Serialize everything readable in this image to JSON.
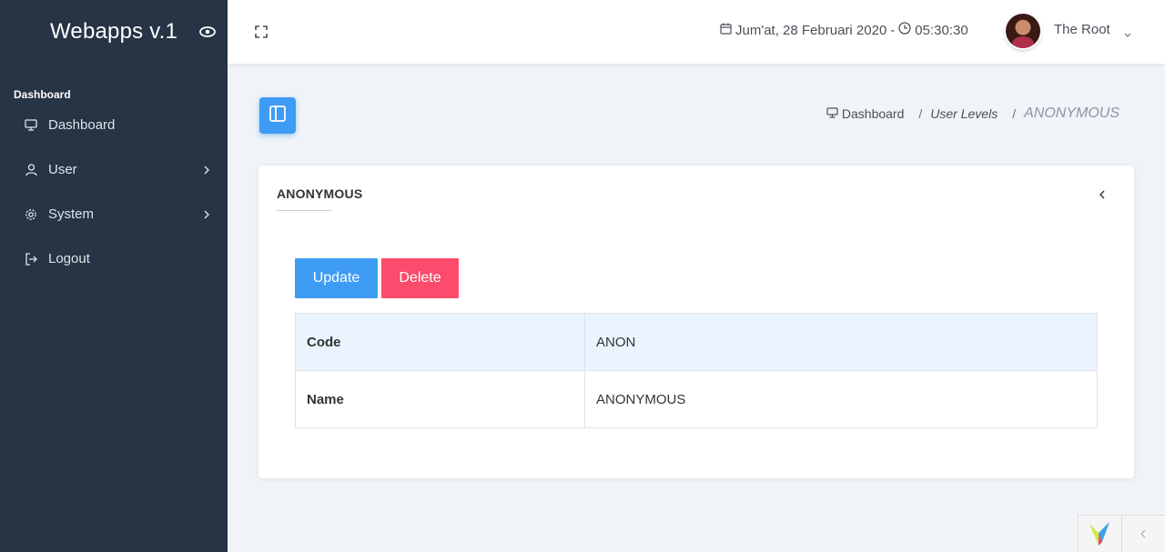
{
  "app": {
    "title": "Webapps v.1"
  },
  "sidebar": {
    "section_header": "Dashboard",
    "items": [
      {
        "label": "Dashboard",
        "icon": "monitor-icon",
        "has_children": false
      },
      {
        "label": "User",
        "icon": "user-icon",
        "has_children": true
      },
      {
        "label": "System",
        "icon": "gear-icon",
        "has_children": true
      },
      {
        "label": "Logout",
        "icon": "logout-icon",
        "has_children": false
      }
    ]
  },
  "header": {
    "date": "Jum'at, 28 Februari 2020",
    "separator": "-",
    "time": "05:30:30",
    "username": "The Root"
  },
  "breadcrumb": {
    "items": [
      "Dashboard",
      "User Levels",
      "ANONYMOUS"
    ],
    "separator": "/"
  },
  "card": {
    "title": "ANONYMOUS",
    "buttons": {
      "update": "Update",
      "delete": "Delete"
    },
    "rows": [
      {
        "label": "Code",
        "value": "ANON"
      },
      {
        "label": "Name",
        "value": "ANONYMOUS"
      }
    ]
  },
  "colors": {
    "sidebar_bg": "#263445",
    "primary": "#3f9cf5",
    "danger": "#fc4b6c",
    "page_bg": "#f0f4f8"
  }
}
